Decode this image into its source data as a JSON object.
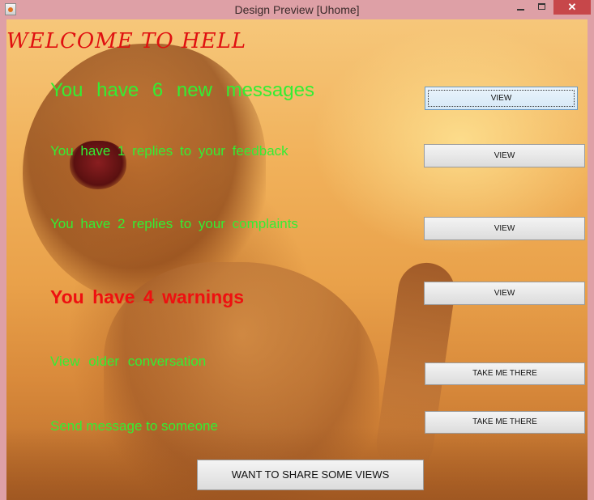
{
  "window": {
    "title": "Design Preview [Uhome]",
    "icon": "java-app-icon",
    "controls": [
      "minimize-icon",
      "maximize-icon",
      "close-icon"
    ],
    "close_glyph": "✕"
  },
  "main": {
    "welcome": "WELCOME  TO  HELL",
    "rows": [
      {
        "text": "You   have  6  new   messages",
        "button": "VIEW"
      },
      {
        "text": "You  have  1  replies to your feedback",
        "button": "VIEW"
      },
      {
        "text": "You  have  2  replies to your complaints",
        "button": "VIEW"
      },
      {
        "text": "You  have  4 warnings",
        "button": "VIEW"
      },
      {
        "text": "View  older  conversation",
        "button": "TAKE ME THERE"
      },
      {
        "text": "Send message to someone",
        "button": "TAKE ME THERE"
      }
    ],
    "share_button": "WANT TO SHARE SOME VIEWS"
  },
  "colors": {
    "message_text": "#33ee33",
    "warning_text": "#ee1010",
    "welcome_text": "#e01010",
    "window_frame": "#dea0a6"
  }
}
